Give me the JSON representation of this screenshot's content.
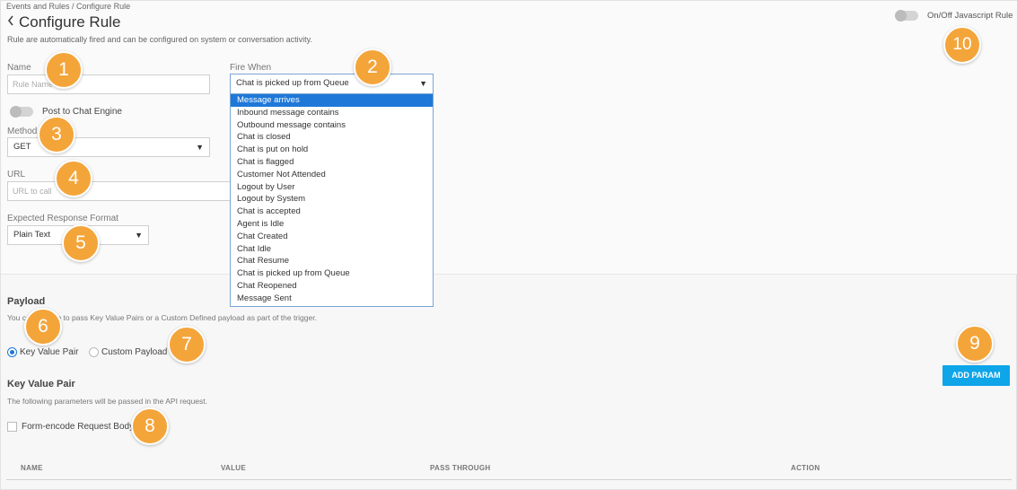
{
  "header": {
    "breadcrumb": "Events and Rules / Configure Rule",
    "title": "Configure Rule",
    "description": "Rule are automatically fired and can be configured on system or conversation activity."
  },
  "js_toggle": {
    "label": "On/Off Javascript Rule",
    "on": false
  },
  "form": {
    "name_label": "Name",
    "name_placeholder": "Rule Name",
    "post_to_chat_label": "Post to Chat Engine",
    "method_label": "Method",
    "method_value": "GET",
    "url_label": "URL",
    "url_placeholder": "URL to call",
    "response_format_label": "Expected Response Format",
    "response_format_value": "Plain Text",
    "fire_when_label": "Fire When",
    "fire_when_value": "Chat is picked up from Queue"
  },
  "dropdown": {
    "options": [
      "Message arrives",
      "Inbound message contains",
      "Outbound message contains",
      "Chat is closed",
      "Chat is put on hold",
      "Chat is flagged",
      "Customer Not Attended",
      "Logout by User",
      "Logout by System",
      "Chat is accepted",
      "Agent is Idle",
      "Chat Created",
      "Chat Idle",
      "Chat Resume",
      "Chat is picked up from Queue",
      "Chat Reopened",
      "Message Sent"
    ],
    "highlighted_index": 0
  },
  "payload": {
    "title": "Payload",
    "description": "You can choose to pass Key Value Pairs or a Custom Defined payload as part of the trigger.",
    "option_kv": "Key Value Pair",
    "option_custom": "Custom Payload",
    "selected": "Key Value Pair"
  },
  "kv": {
    "title": "Key Value Pair",
    "description": "The following parameters will be passed in the API request.",
    "form_encode_label": "Form-encode Request Body",
    "add_param_label": "ADD PARAM"
  },
  "table": {
    "columns": [
      "NAME",
      "VALUE",
      "PASS THROUGH",
      "ACTION"
    ]
  },
  "badges": [
    "1",
    "2",
    "3",
    "4",
    "5",
    "6",
    "7",
    "8",
    "9",
    "10"
  ],
  "colors": {
    "accent": "#1e78d7",
    "button": "#0ea5e9",
    "badge": "#f4a53a"
  }
}
